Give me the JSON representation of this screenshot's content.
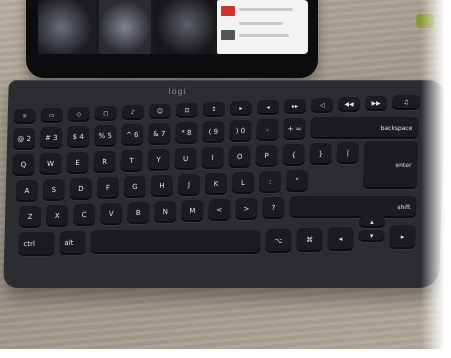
{
  "scene": {
    "description_tags": [
      "tablet",
      "keyboard",
      "desk"
    ],
    "keyboard_brand": "logi"
  },
  "keyboard": {
    "row_number": [
      "@\n2",
      "#\n3",
      "$\n4",
      "%\n5",
      "^\n6",
      "&\n7",
      "*\n8",
      "(\n9",
      ")\n0",
      "-",
      "+\n="
    ],
    "row_qwerty": [
      "Q",
      "W",
      "E",
      "R",
      "T",
      "Y",
      "U",
      "I",
      "O",
      "P"
    ],
    "row_home": [
      "A",
      "S",
      "D",
      "F",
      "G",
      "H",
      "J",
      "K",
      "L"
    ],
    "row_bottom": [
      "Z",
      "X",
      "C",
      "V",
      "B",
      "N",
      "M"
    ],
    "backspace_label": "backspace",
    "enter_label": "enter",
    "shift_label": "shift",
    "ctrl_label": "ctrl",
    "alt_label": "alt"
  }
}
